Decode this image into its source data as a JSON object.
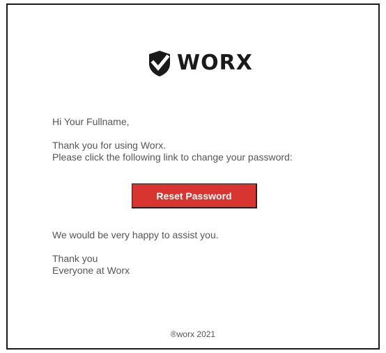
{
  "brand": {
    "name": "WORX",
    "icon": "shield-check-icon",
    "color": "#1a1a1a"
  },
  "greeting": "Hi Your Fullname,",
  "paragraph_1": {
    "line_1": "Thank you for using Worx.",
    "line_2": "Please click the following link to change your password:"
  },
  "reset_button": {
    "label": "Reset Password",
    "color": "#d93530"
  },
  "assist_text": "We would be very happy to assist you.",
  "signoff": {
    "line_1": "Thank you",
    "line_2": "Everyone at Worx"
  },
  "footer": "®worx 2021"
}
